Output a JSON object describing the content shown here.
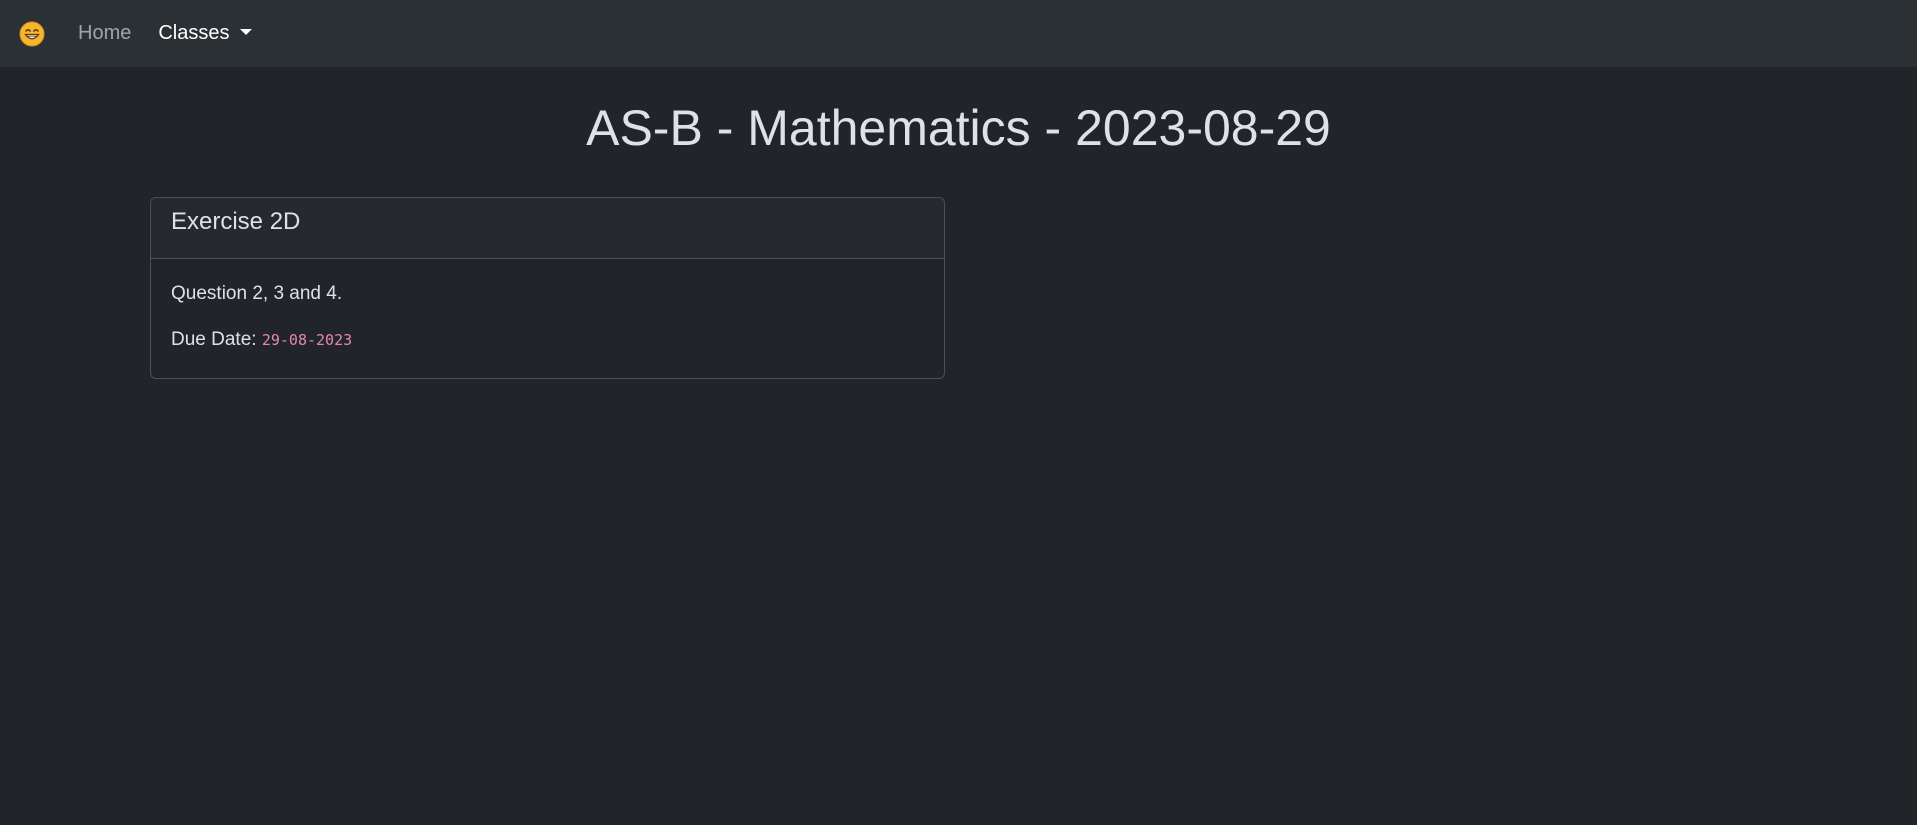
{
  "navbar": {
    "brand_icon": "grinning-face-icon",
    "items": [
      {
        "label": "Home"
      },
      {
        "label": "Classes",
        "dropdown": true
      }
    ]
  },
  "page": {
    "title": "AS-B - Mathematics - 2023-08-29"
  },
  "assignment": {
    "title": "Exercise 2D",
    "description": "Question 2, 3 and 4.",
    "due_label": "Due Date:",
    "due_value": "29-08-2023"
  },
  "colors": {
    "background": "#212529",
    "navbar": "#2b3035",
    "code_pink": "#e685b5"
  }
}
